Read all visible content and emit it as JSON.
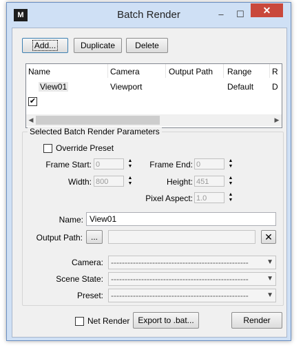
{
  "window": {
    "title": "Batch Render",
    "app_icon_text": "M",
    "minimize_glyph": "–",
    "maximize_glyph": "☐",
    "close_glyph": "✕"
  },
  "toolbar": {
    "add_label": "Add...",
    "duplicate_label": "Duplicate",
    "delete_label": "Delete"
  },
  "list": {
    "columns": [
      "Name",
      "Camera",
      "Output Path",
      "Range",
      "R"
    ],
    "rows": [
      {
        "checked": true,
        "name": "View01",
        "camera": "Viewport",
        "output_path": "",
        "range": "Default",
        "r": "D"
      }
    ],
    "scroll_left_glyph": "◀",
    "scroll_right_glyph": "▶"
  },
  "params": {
    "group_title": "Selected Batch Render Parameters",
    "override_preset_label": "Override Preset",
    "override_preset_checked": false,
    "frame_start_label": "Frame Start:",
    "frame_start_value": "0",
    "frame_end_label": "Frame End:",
    "frame_end_value": "0",
    "width_label": "Width:",
    "width_value": "800",
    "height_label": "Height:",
    "height_value": "451",
    "pixel_aspect_label": "Pixel Aspect:",
    "pixel_aspect_value": "1.0",
    "name_label": "Name:",
    "name_value": "View01",
    "output_path_label": "Output Path:",
    "output_path_browse": "...",
    "output_path_value": "",
    "clear_glyph": "✕",
    "camera_label": "Camera:",
    "camera_value": "--------------------------------------------------",
    "scene_state_label": "Scene State:",
    "scene_state_value": "--------------------------------------------------",
    "preset_label": "Preset:",
    "preset_value": "--------------------------------------------------"
  },
  "footer": {
    "net_render_label": "Net Render",
    "net_render_checked": false,
    "export_label": "Export to .bat...",
    "render_label": "Render"
  }
}
